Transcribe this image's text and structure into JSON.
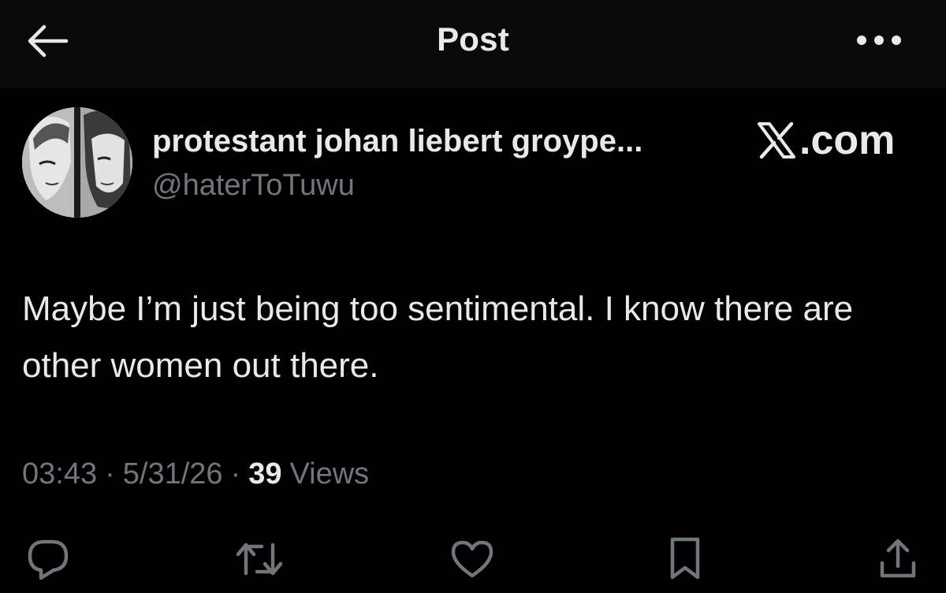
{
  "header": {
    "title": "Post",
    "back_icon": "arrow-left-icon",
    "more_icon": "more-horizontal-icon"
  },
  "author": {
    "display_name": "protestant johan liebert groype...",
    "handle": "@haterToTuwu",
    "avatar_icon": "avatar-image"
  },
  "watermark": {
    "text": ".com",
    "logo_icon": "x-logo-icon"
  },
  "tweet": {
    "text": "Maybe I’m just being too sentimental. I know there are other women out there."
  },
  "meta": {
    "time": "03:43",
    "date": "5/31/26",
    "views_count": "39",
    "views_label": "Views",
    "separator": "·"
  },
  "actions": {
    "reply_icon": "reply-icon",
    "retweet_icon": "retweet-icon",
    "like_icon": "heart-icon",
    "bookmark_icon": "bookmark-icon",
    "share_icon": "share-icon"
  },
  "colors": {
    "background": "#000000",
    "header_background": "#0a0a0a",
    "primary_text": "#e7e9ea",
    "secondary_text": "#71767b"
  }
}
